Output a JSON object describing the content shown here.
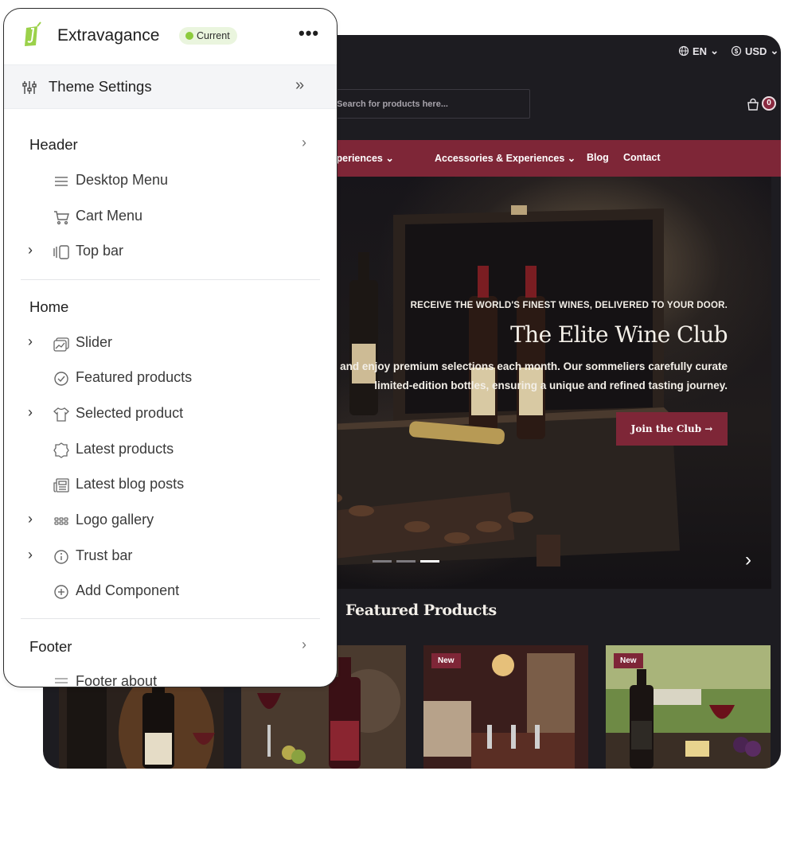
{
  "store": {
    "locale": {
      "language": "EN",
      "currency": "USD"
    },
    "search": {
      "placeholder": "Search for products here..."
    },
    "cart": {
      "count": "0"
    },
    "nav": [
      {
        "label": "Wine Experiences"
      },
      {
        "label": "Accessories & Experiences"
      },
      {
        "label": "Blog"
      },
      {
        "label": "Contact"
      }
    ],
    "hero": {
      "kicker": "RECEIVE THE WORLD'S FINEST WINES, DELIVERED TO YOUR DOOR.",
      "title": "The Elite Wine Club",
      "description_line1": "Join and enjoy premium selections each month. Our sommeliers carefully curate",
      "description_line2": "limited-edition bottles, ensuring a unique and refined tasting journey.",
      "button": "Join the Club →",
      "active_slide": 3,
      "slide_count": 3
    },
    "featured": {
      "title": "Featured Products",
      "products": [
        {
          "badge": ""
        },
        {
          "badge": ""
        },
        {
          "badge": "New"
        },
        {
          "badge": "New"
        }
      ]
    },
    "colors": {
      "accent": "#7e2637",
      "background": "#1d1c21"
    }
  },
  "editor": {
    "app_name": "Extravagance",
    "status": "Current",
    "more_label": "•••",
    "settings_label": "Theme Settings",
    "sections": {
      "header": {
        "title": "Header",
        "items": [
          {
            "label": "Desktop Menu",
            "icon": "menu-icon"
          },
          {
            "label": "Cart Menu",
            "icon": "cart-icon"
          },
          {
            "label": "Top bar",
            "icon": "top-bar-icon"
          }
        ]
      },
      "home": {
        "title": "Home",
        "items": [
          {
            "label": "Slider",
            "icon": "image-icon"
          },
          {
            "label": "Featured products",
            "icon": "check-circle-icon"
          },
          {
            "label": "Selected product",
            "icon": "shirt-icon"
          },
          {
            "label": "Latest products",
            "icon": "badge-icon"
          },
          {
            "label": "Latest blog posts",
            "icon": "newspaper-icon"
          },
          {
            "label": "Logo gallery",
            "icon": "grid-icon"
          },
          {
            "label": "Trust bar",
            "icon": "info-icon"
          },
          {
            "label": "Add Component",
            "icon": "plus-circle-icon"
          }
        ]
      },
      "footer": {
        "title": "Footer",
        "items": [
          {
            "label": "Footer about",
            "icon": "menu-icon"
          }
        ]
      }
    }
  }
}
